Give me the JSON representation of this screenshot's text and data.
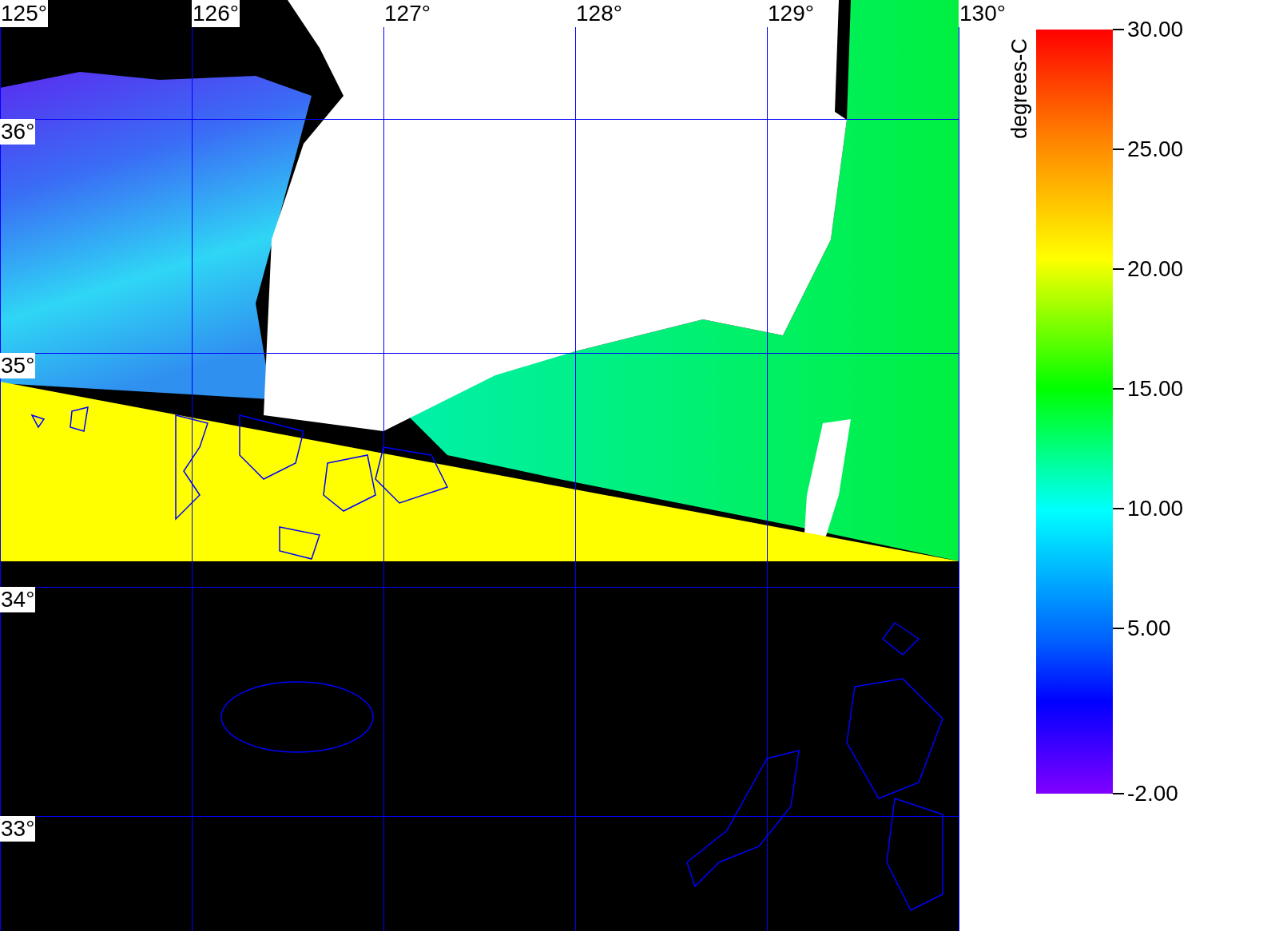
{
  "map": {
    "longitude_labels": [
      "125°",
      "126°",
      "127°",
      "128°",
      "129°",
      "130°"
    ],
    "latitude_labels": [
      "36°",
      "35°",
      "34°",
      "33°"
    ]
  },
  "colorbar": {
    "title": "degrees-C",
    "tick_labels": [
      "30.00",
      "25.00",
      "20.00",
      "15.00",
      "10.00",
      "5.00",
      "-2.00"
    ]
  }
}
